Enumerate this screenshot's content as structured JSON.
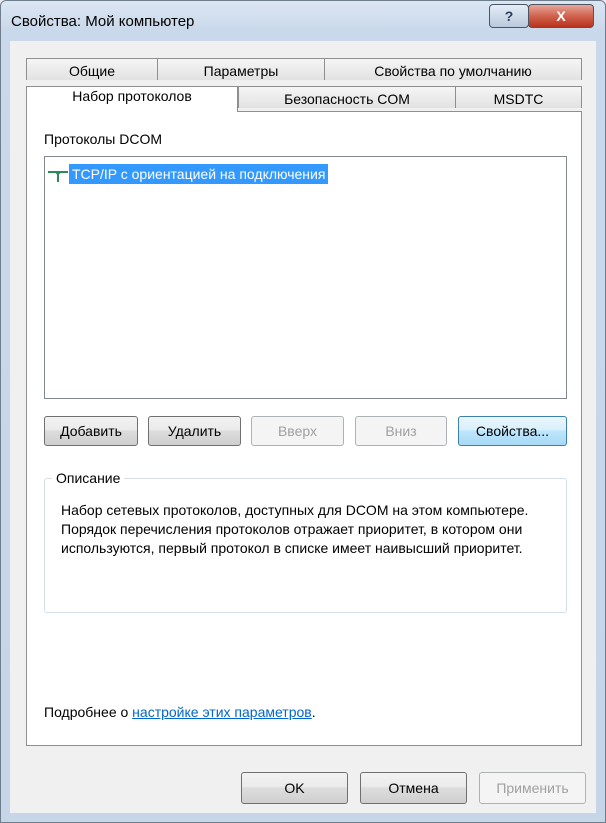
{
  "window": {
    "title": "Свойства: Мой компьютер",
    "help_glyph": "?",
    "close_glyph": "X"
  },
  "tabs": {
    "row1": [
      "Общие",
      "Параметры",
      "Свойства по умолчанию"
    ],
    "row2": [
      "Набор протоколов",
      "Безопасность COM",
      "MSDTC"
    ],
    "active": "Набор протоколов"
  },
  "protocols": {
    "label": "Протоколы DCOM",
    "items": [
      "TCP/IP с ориентацией на подключения"
    ],
    "selected": "TCP/IP с ориентацией на подключения"
  },
  "buttons": {
    "add": "Добавить",
    "remove": "Удалить",
    "up": "Вверх",
    "down": "Вниз",
    "properties": "Свойства..."
  },
  "description": {
    "legend": "Описание",
    "text": "Набор сетевых протоколов, доступных для DCOM на этом компьютере. Порядок перечисления протоколов отражает приоритет, в котором они используются, первый протокол в списке имеет наивысший приоритет."
  },
  "more_info": {
    "prefix": "Подробнее о ",
    "link": "настройке этих параметров",
    "suffix": "."
  },
  "footer": {
    "ok": "OK",
    "cancel": "Отмена",
    "apply": "Применить"
  },
  "colors": {
    "selection": "#3399ff",
    "link": "#0066cc",
    "close_button": "#c8432c"
  }
}
